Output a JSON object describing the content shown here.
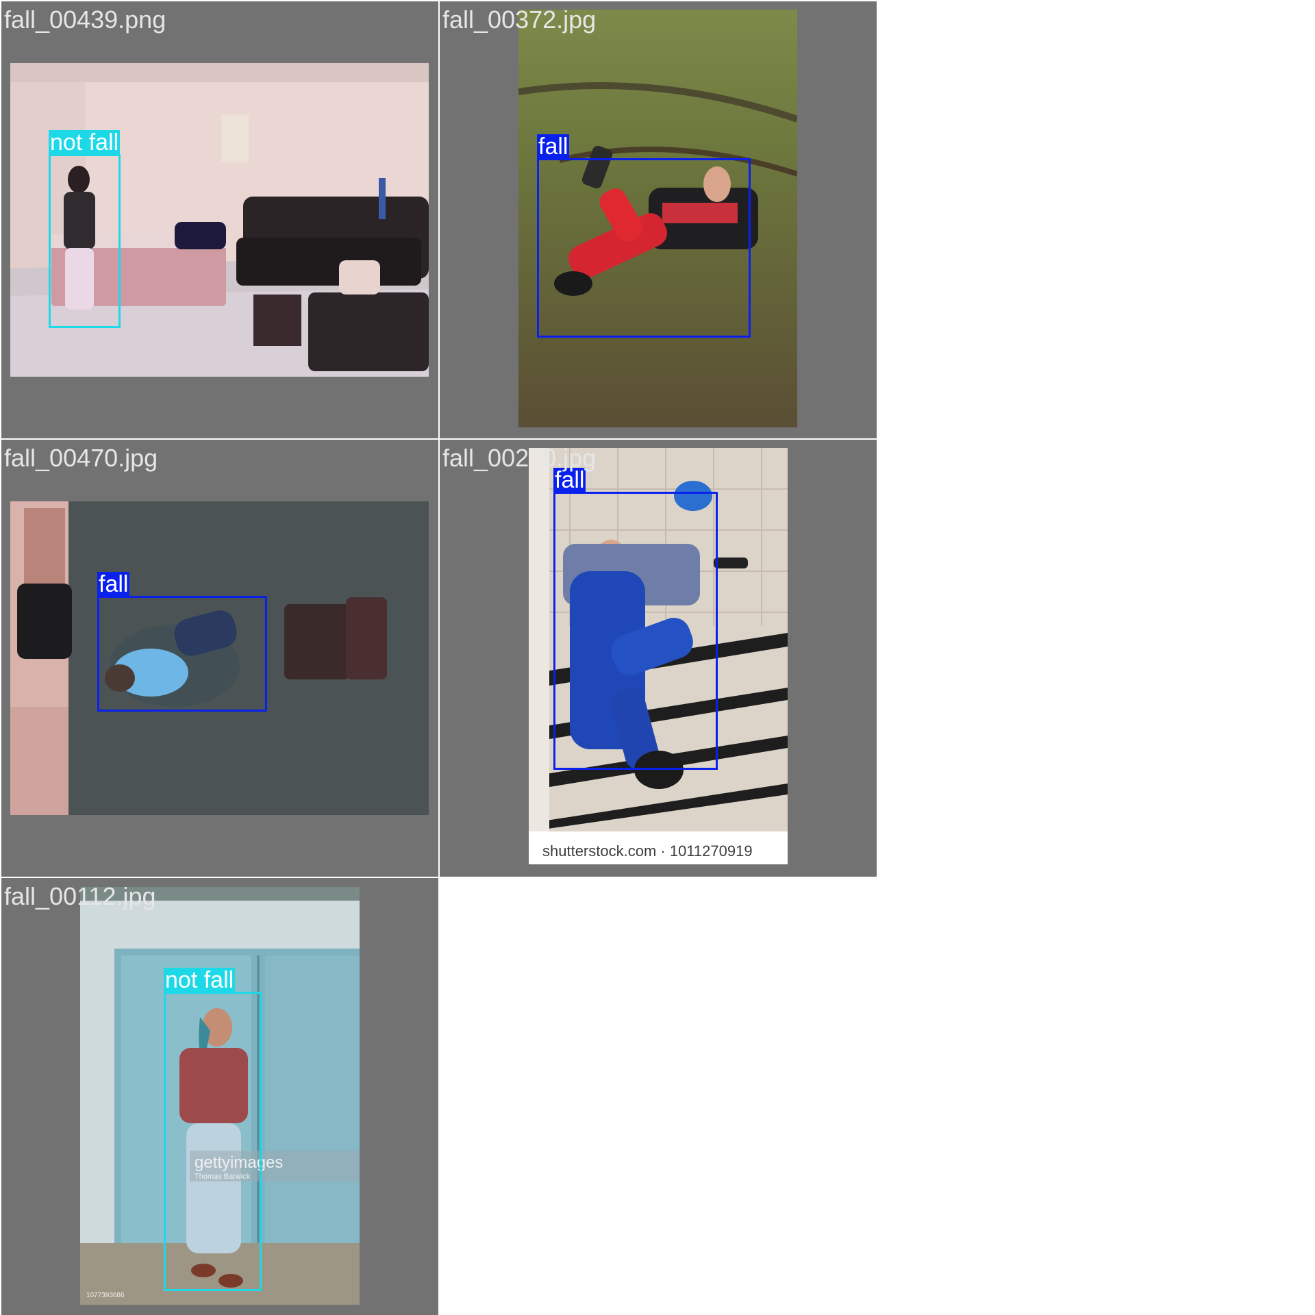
{
  "colors": {
    "fall": "#0a21ee",
    "not_fall": "#1dd9e8",
    "tile_bg": "#727272"
  },
  "tiles": [
    {
      "filename": "fall_00439.png",
      "detections": [
        {
          "label": "not fall",
          "class": "not_fall"
        }
      ]
    },
    {
      "filename": "fall_00372.jpg",
      "detections": [
        {
          "label": "fall",
          "class": "fall"
        }
      ]
    },
    {
      "filename": "fall_00470.jpg",
      "detections": [
        {
          "label": "fall",
          "class": "fall"
        }
      ]
    },
    {
      "filename": "fall_00270.jpg",
      "detections": [
        {
          "label": "fall",
          "class": "fall"
        }
      ],
      "watermark": "shutterstock.com · 1011270919"
    },
    {
      "filename": "fall_00112.jpg",
      "detections": [
        {
          "label": "not fall",
          "class": "not_fall"
        }
      ],
      "watermark": "gettyimages",
      "watermark_credit": "Thomas Barwick",
      "image_id": "1077393686"
    }
  ]
}
